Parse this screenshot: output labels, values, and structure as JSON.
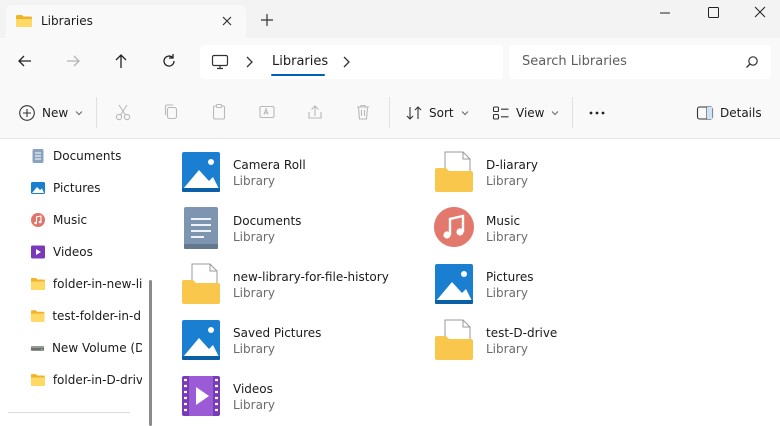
{
  "window": {
    "tab_title": "Libraries",
    "new_tab": "+"
  },
  "address": {
    "crumb": "Libraries",
    "search_placeholder": "Search Libraries"
  },
  "toolbar": {
    "new_label": "New",
    "sort_label": "Sort",
    "view_label": "View",
    "more_label": "...",
    "details_label": "Details"
  },
  "sidebar": {
    "items": [
      {
        "label": "Documents",
        "icon": "documents-icon",
        "pinned": true
      },
      {
        "label": "Pictures",
        "icon": "pictures-icon",
        "pinned": true
      },
      {
        "label": "Music",
        "icon": "music-icon",
        "pinned": true
      },
      {
        "label": "Videos",
        "icon": "videos-icon",
        "pinned": true
      },
      {
        "label": "folder-in-new-li",
        "icon": "folder-icon",
        "pinned": false
      },
      {
        "label": "test-folder-in-dr",
        "icon": "folder-icon",
        "pinned": false
      },
      {
        "label": "New Volume (D:",
        "icon": "drive-icon",
        "pinned": false
      },
      {
        "label": "folder-in-D-driv",
        "icon": "folder-icon",
        "pinned": false
      }
    ]
  },
  "libraries": [
    {
      "name": "Camera Roll",
      "type": "Library",
      "icon": "pictures-library-icon"
    },
    {
      "name": "D-liarary",
      "type": "Library",
      "icon": "folder-library-icon"
    },
    {
      "name": "Documents",
      "type": "Library",
      "icon": "documents-library-icon"
    },
    {
      "name": "Music",
      "type": "Library",
      "icon": "music-library-icon"
    },
    {
      "name": "new-library-for-file-history",
      "type": "Library",
      "icon": "folder-library-icon"
    },
    {
      "name": "Pictures",
      "type": "Library",
      "icon": "pictures-library-icon"
    },
    {
      "name": "Saved Pictures",
      "type": "Library",
      "icon": "pictures-library-icon"
    },
    {
      "name": "test-D-drive",
      "type": "Library",
      "icon": "folder-library-icon"
    },
    {
      "name": "Videos",
      "type": "Library",
      "icon": "videos-library-icon"
    }
  ],
  "colors": {
    "accent": "#005fb8",
    "folder": "#f8c74c",
    "picture_blue": "#1a7fd1"
  }
}
